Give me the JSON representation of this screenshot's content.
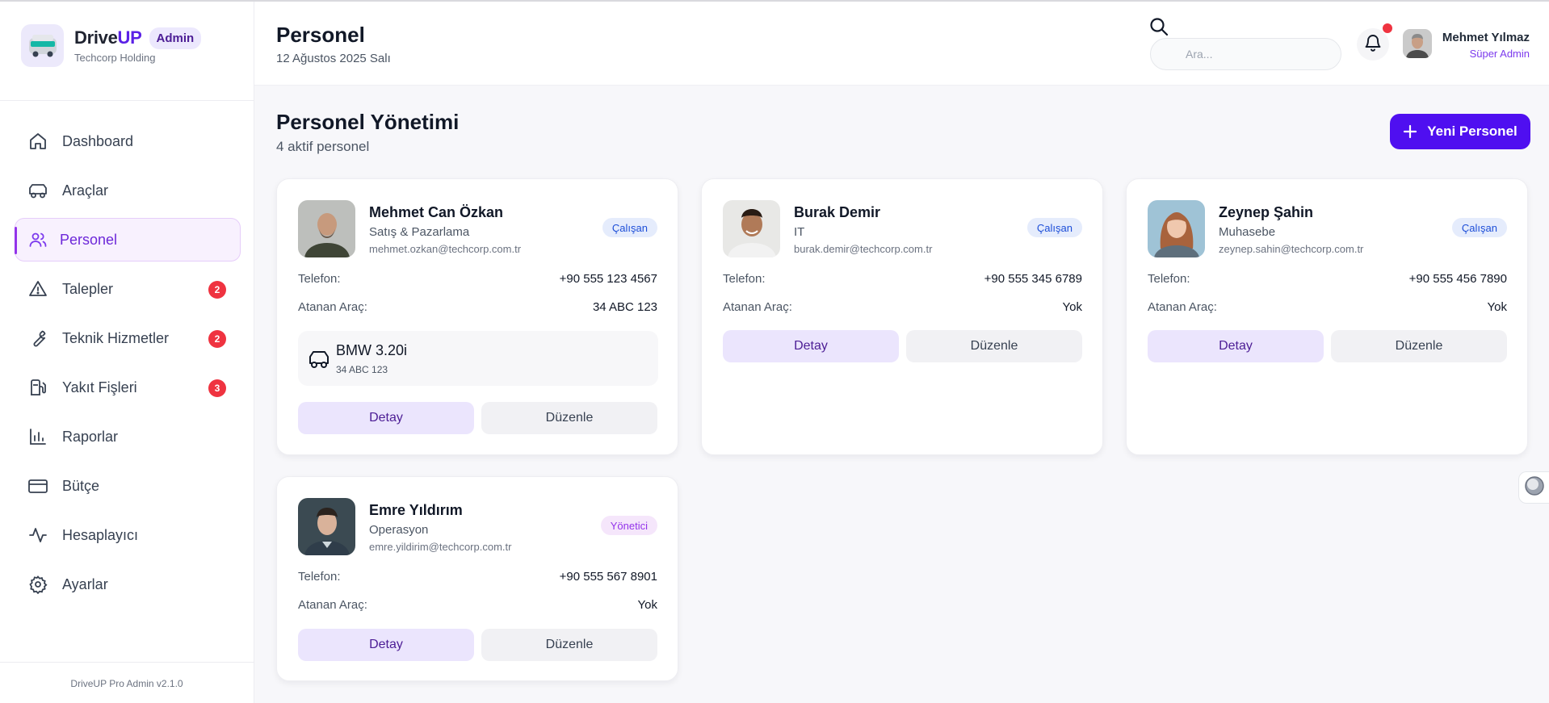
{
  "brand": {
    "name_main": "Drive",
    "name_accent": "UP",
    "badge": "Admin",
    "company": "Techcorp Holding"
  },
  "sidebar": {
    "items": [
      {
        "label": "Dashboard",
        "icon": "home-icon"
      },
      {
        "label": "Araçlar",
        "icon": "car-icon"
      },
      {
        "label": "Personel",
        "icon": "users-icon",
        "active": true
      },
      {
        "label": "Talepler",
        "icon": "alert-triangle-icon",
        "badge": "2"
      },
      {
        "label": "Teknik Hizmetler",
        "icon": "wrench-icon",
        "badge": "2"
      },
      {
        "label": "Yakıt Fişleri",
        "icon": "fuel-icon",
        "badge": "3"
      },
      {
        "label": "Raporlar",
        "icon": "bar-chart-icon"
      },
      {
        "label": "Bütçe",
        "icon": "credit-card-icon"
      },
      {
        "label": "Hesaplayıcı",
        "icon": "activity-icon"
      },
      {
        "label": "Ayarlar",
        "icon": "gear-icon"
      }
    ],
    "version": "DriveUP Pro Admin v2.1.0"
  },
  "header": {
    "title": "Personel",
    "date": "12 Ağustos 2025 Salı",
    "search_placeholder": "Ara...",
    "user": {
      "name": "Mehmet Yılmaz",
      "role": "Süper Admin"
    }
  },
  "main": {
    "title": "Personel Yönetimi",
    "subtitle": "4 aktif personel",
    "new_button": "Yeni Personel",
    "phone_label": "Telefon:",
    "vehicle_label": "Atanan Araç:",
    "detail_label": "Detay",
    "edit_label": "Düzenle",
    "cards": [
      {
        "name": "Mehmet Can Özkan",
        "dept": "Satış & Pazarlama",
        "email": "mehmet.ozkan@techcorp.com.tr",
        "role": "Çalışan",
        "phone": "+90 555 123 4567",
        "vehicle": "34 ABC 123",
        "vehicle_model": "BMW 3.20i",
        "vehicle_plate": "34 ABC 123"
      },
      {
        "name": "Burak Demir",
        "dept": "IT",
        "email": "burak.demir@techcorp.com.tr",
        "role": "Çalışan",
        "phone": "+90 555 345 6789",
        "vehicle": "Yok"
      },
      {
        "name": "Zeynep Şahin",
        "dept": "Muhasebe",
        "email": "zeynep.sahin@techcorp.com.tr",
        "role": "Çalışan",
        "phone": "+90 555 456 7890",
        "vehicle": "Yok"
      },
      {
        "name": "Emre Yıldırım",
        "dept": "Operasyon",
        "email": "emre.yildirim@techcorp.com.tr",
        "role": "Yönetici",
        "phone": "+90 555 567 8901",
        "vehicle": "Yok"
      }
    ]
  },
  "colors": {
    "accent": "#4f0ff0",
    "active_nav": "#6d28d9",
    "badge_red": "#ef3340",
    "employee_badge": "#1d4ed8",
    "manager_badge": "#9333ea"
  }
}
